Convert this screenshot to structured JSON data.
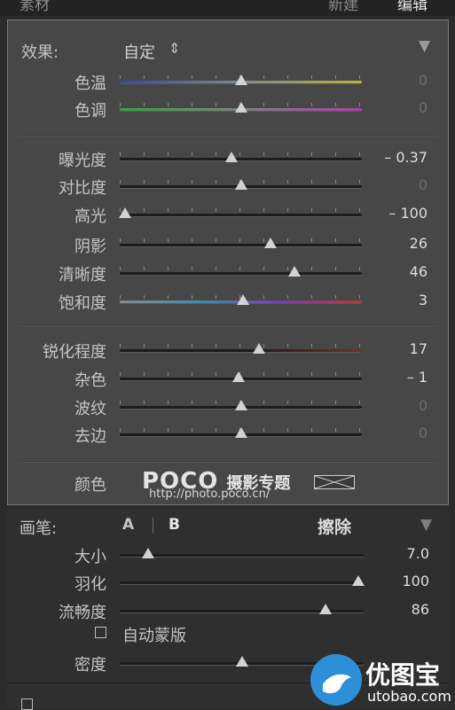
{
  "topbar": {
    "left_label": "素材",
    "new_label": "新建",
    "edit_label": "编辑"
  },
  "panel": {
    "effect_label": "效果:",
    "effect_value": "自定",
    "effect_stepper": "⇕",
    "collapse_glyph": "▼",
    "groups": [
      [
        {
          "label": "色温",
          "value": "0",
          "level": 0.5,
          "gradient": "temp"
        },
        {
          "label": "色调",
          "value": "0",
          "level": 0.5,
          "gradient": "tint"
        }
      ],
      [
        {
          "label": "曝光度",
          "value": "– 0.37",
          "level": 0.46
        },
        {
          "label": "对比度",
          "value": "0",
          "level": 0.5
        },
        {
          "label": "高光",
          "value": "– 100",
          "level": 0.0
        },
        {
          "label": "阴影",
          "value": "26",
          "level": 0.63
        },
        {
          "label": "清晰度",
          "value": "46",
          "level": 0.73
        },
        {
          "label": "饱和度",
          "value": "3",
          "level": 0.51,
          "gradient": "sat"
        }
      ],
      [
        {
          "label": "锐化程度",
          "value": "17",
          "level": 0.58,
          "gradient": "sharp"
        },
        {
          "label": "杂色",
          "value": "– 1",
          "level": 0.49
        },
        {
          "label": "波纹",
          "value": "0",
          "level": 0.5
        },
        {
          "label": "去边",
          "value": "0",
          "level": 0.5
        }
      ]
    ],
    "color_label": "颜色"
  },
  "brush": {
    "label": "画笔:",
    "tab_a": "A",
    "tab_b": "B",
    "erase": "擦除",
    "collapse_glyph": "▼",
    "sliders": [
      {
        "label": "大小",
        "value": "7.0",
        "level": 0.1
      },
      {
        "label": "羽化",
        "value": "100",
        "level": 1.0
      },
      {
        "label": "流畅度",
        "value": "86",
        "level": 0.86
      }
    ],
    "automask_label": "自动蒙版",
    "density": {
      "label": "密度",
      "value": "",
      "level": 0.5
    }
  },
  "watermark": {
    "poco_logo": "POCO",
    "poco_title": "摄影专题",
    "poco_url": "http://photo.poco.cn/",
    "utobao_name": "优图宝",
    "utobao_url": "utobao.com"
  },
  "colors": {
    "panel": "#474747",
    "accent_blue": "#2e8fd9"
  }
}
